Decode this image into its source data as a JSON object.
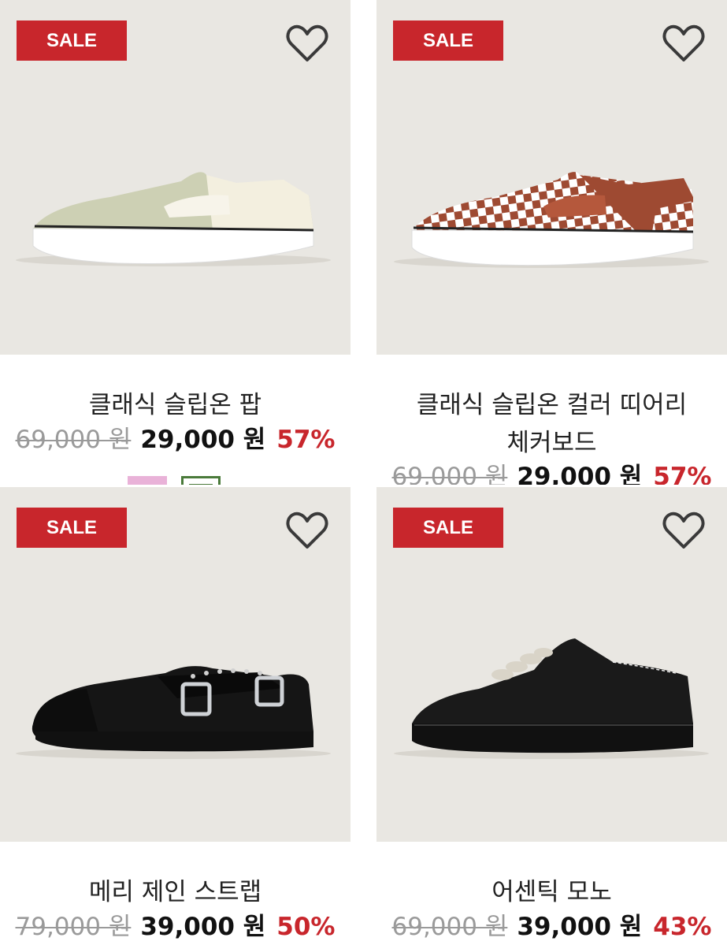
{
  "products": [
    {
      "badge": "SALE",
      "name": "클래식 슬립온 팝",
      "original_price": "69,000 원",
      "sale_price": "29,000 원",
      "discount": "57%",
      "shoe_colors": {
        "upper": "#cdd0b4",
        "collar": "#f3efdf",
        "sole": "#ffffff"
      },
      "swatches": [
        "#e9b2d8",
        "#4a7a3a"
      ]
    },
    {
      "badge": "SALE",
      "name": "클래식 슬립온 컬러 띠어리 체커보드",
      "name_lines": [
        "클래식 슬립온 컬러 띠어리",
        "체커보드"
      ],
      "original_price": "69,000 원",
      "sale_price": "29,000 원",
      "discount": "57%",
      "shoe_colors": {
        "upper": "#9e4a32",
        "check": "#ffffff",
        "sole": "#ffffff"
      }
    },
    {
      "badge": "SALE",
      "name": "메리 제인 스트랩",
      "original_price": "79,000 원",
      "sale_price": "39,000 원",
      "discount": "50%",
      "shoe_colors": {
        "upper": "#151515",
        "buckle": "#cfd2d6",
        "sole": "#111111"
      }
    },
    {
      "badge": "SALE",
      "name": "어센틱 모노",
      "original_price": "69,000 원",
      "sale_price": "39,000 원",
      "discount": "43%",
      "shoe_colors": {
        "upper": "#1a1a1a",
        "laces": "#d9d4c8",
        "sole": "#111111"
      }
    }
  ],
  "colors": {
    "sale_badge": "#c8262c",
    "discount": "#c8262c",
    "image_bg": "#e9e7e2",
    "strikethrough": "#9a9a9a"
  }
}
